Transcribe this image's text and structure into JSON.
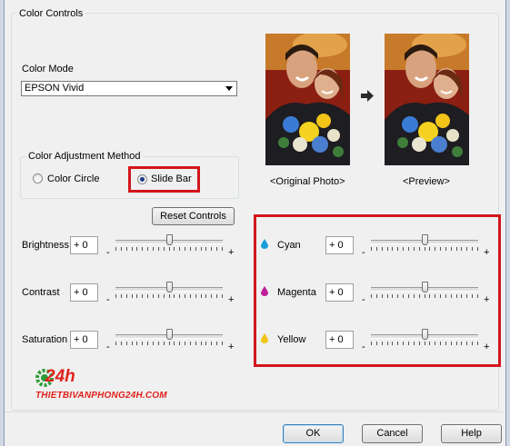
{
  "group": {
    "title": "Color Controls"
  },
  "color_mode": {
    "label": "Color Mode",
    "selected": "EPSON Vivid"
  },
  "adjustment_method": {
    "title": "Color Adjustment Method",
    "options": [
      {
        "label": "Color Circle",
        "checked": false
      },
      {
        "label": "Slide Bar",
        "checked": true
      }
    ]
  },
  "buttons": {
    "reset": "Reset Controls",
    "ok": "OK",
    "cancel": "Cancel",
    "help": "Help"
  },
  "preview": {
    "original_label": "<Original Photo>",
    "preview_label": "<Preview>"
  },
  "sliders": {
    "brightness": {
      "label": "Brightness",
      "value": "+ 0",
      "level": 0
    },
    "contrast": {
      "label": "Contrast",
      "value": "+ 0",
      "level": 0
    },
    "saturation": {
      "label": "Saturation",
      "value": "+ 0",
      "level": 0
    },
    "cyan": {
      "label": "Cyan",
      "value": "+ 0",
      "level": 0,
      "color": "#1a9ed8"
    },
    "magenta": {
      "label": "Magenta",
      "value": "+ 0",
      "level": 0,
      "color": "#c01e9a"
    },
    "yellow": {
      "label": "Yellow",
      "value": "+ 0",
      "level": 0,
      "color": "#f2c318"
    }
  },
  "minus": "-",
  "plus": "+",
  "watermark": {
    "text": "THIETBIVANPHONG24H.COM",
    "logo": "24h"
  },
  "highlight_color": "#d3151c",
  "icons": {
    "arrow": "right-arrow-icon",
    "drop": "ink-drop-icon",
    "logo": "gear-logo-icon"
  }
}
